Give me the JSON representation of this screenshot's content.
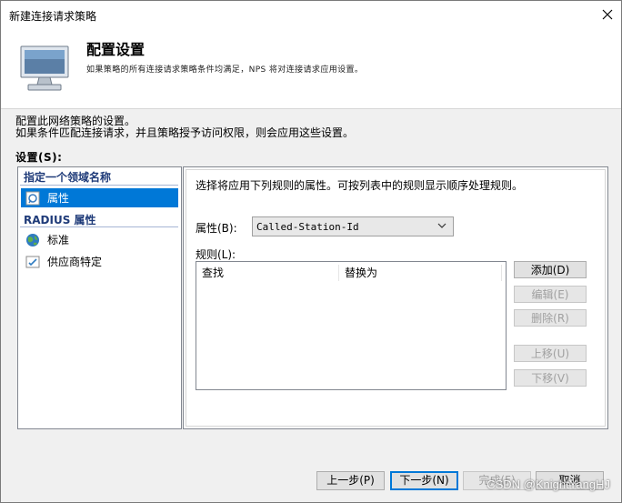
{
  "window": {
    "title": "新建连接请求策略"
  },
  "header": {
    "title": "配置设置",
    "description": "如果策略的所有连接请求策略条件均满足，NPS 将对连接请求应用设置。"
  },
  "intro": {
    "line1": "配置此网络策略的设置。",
    "line2": "如果条件匹配连接请求，并且策略授予访问权限，则会应用这些设置。"
  },
  "settings_label": "设置(S):",
  "sidebar": {
    "section1": "指定一个领域名称",
    "item_attribute": "属性",
    "section2": "RADIUS 属性",
    "item_standard": "标准",
    "item_vendor": "供应商特定"
  },
  "main": {
    "hint": "选择将应用下列规则的属性。可按列表中的规则显示顺序处理规则。",
    "attribute_label": "属性(B):",
    "attribute_value": "Called-Station-Id",
    "rules_label": "规则(L):",
    "col_find": "查找",
    "col_replace": "替换为",
    "btn_add": "添加(D)",
    "btn_edit": "编辑(E)",
    "btn_delete": "删除(R)",
    "btn_up": "上移(U)",
    "btn_down": "下移(V)"
  },
  "footer": {
    "prev": "上一步(P)",
    "next": "下一步(N)",
    "finish": "完成(F)",
    "cancel": "取消"
  },
  "watermark": "CSDN @KnightYangHJ"
}
